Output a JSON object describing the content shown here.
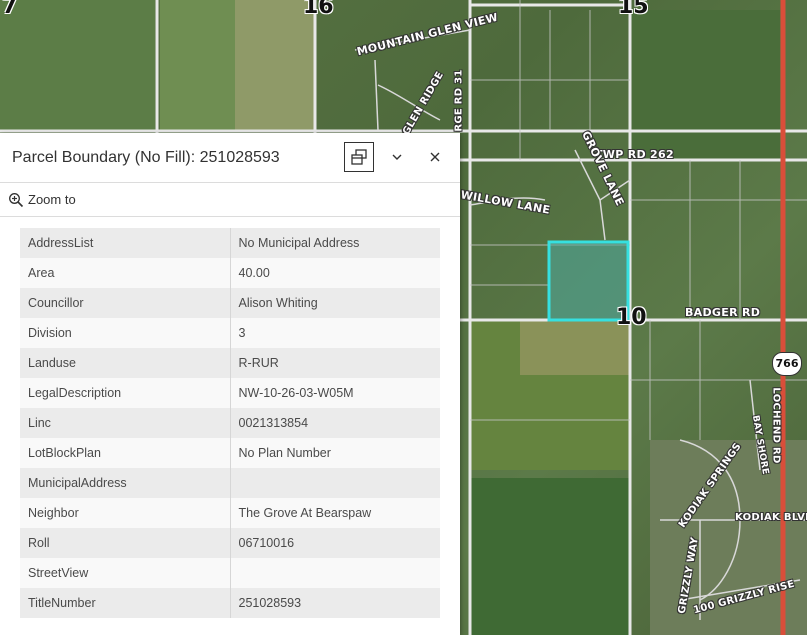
{
  "map": {
    "labels": {
      "mountain_glen_view": "MOUNTAIN GLEN VIEW",
      "twp_rd_262": "TWP RD 262",
      "badger_rd": "BADGER RD",
      "grove_lane": "GROVE LANE",
      "willow_lane": "WILLOW LANE",
      "glen_ridge": "GLEN RIDGE",
      "rge_rd_31": "RGE RD 31",
      "kodiak_springs": "KODIAK SPRINGS",
      "kodiak_blvd": "KODIAK BLVD",
      "grizzly_way": "GRIZZLY WAY",
      "grizzly_rise": "100 GRIZZLY RISE",
      "lochend_rd": "LOCHEND RD",
      "bayshore": "BAY SHORE"
    },
    "section_numbers": {
      "s7": "7",
      "s16": "16",
      "s15": "15",
      "s10": "10"
    },
    "highway_shield": "766",
    "parcel_highlight_color": "#36e0e0"
  },
  "popup": {
    "title": "Parcel Boundary (No Fill): 251028593",
    "zoom_to_label": "Zoom to",
    "attributes": [
      {
        "field": "AddressList",
        "value": "No Municipal Address"
      },
      {
        "field": "Area",
        "value": "40.00"
      },
      {
        "field": "Councillor",
        "value": "Alison Whiting"
      },
      {
        "field": "Division",
        "value": "3"
      },
      {
        "field": "Landuse",
        "value": "R-RUR"
      },
      {
        "field": "LegalDescription",
        "value": "NW-10-26-03-W05M"
      },
      {
        "field": "Linc",
        "value": "0021313854"
      },
      {
        "field": "LotBlockPlan",
        "value": "No Plan Number"
      },
      {
        "field": "MunicipalAddress",
        "value": ""
      },
      {
        "field": "Neighbor",
        "value": "The Grove At Bearspaw"
      },
      {
        "field": "Roll",
        "value": "06710016"
      },
      {
        "field": "StreetView",
        "value": ""
      },
      {
        "field": "TitleNumber",
        "value": "251028593"
      }
    ]
  }
}
